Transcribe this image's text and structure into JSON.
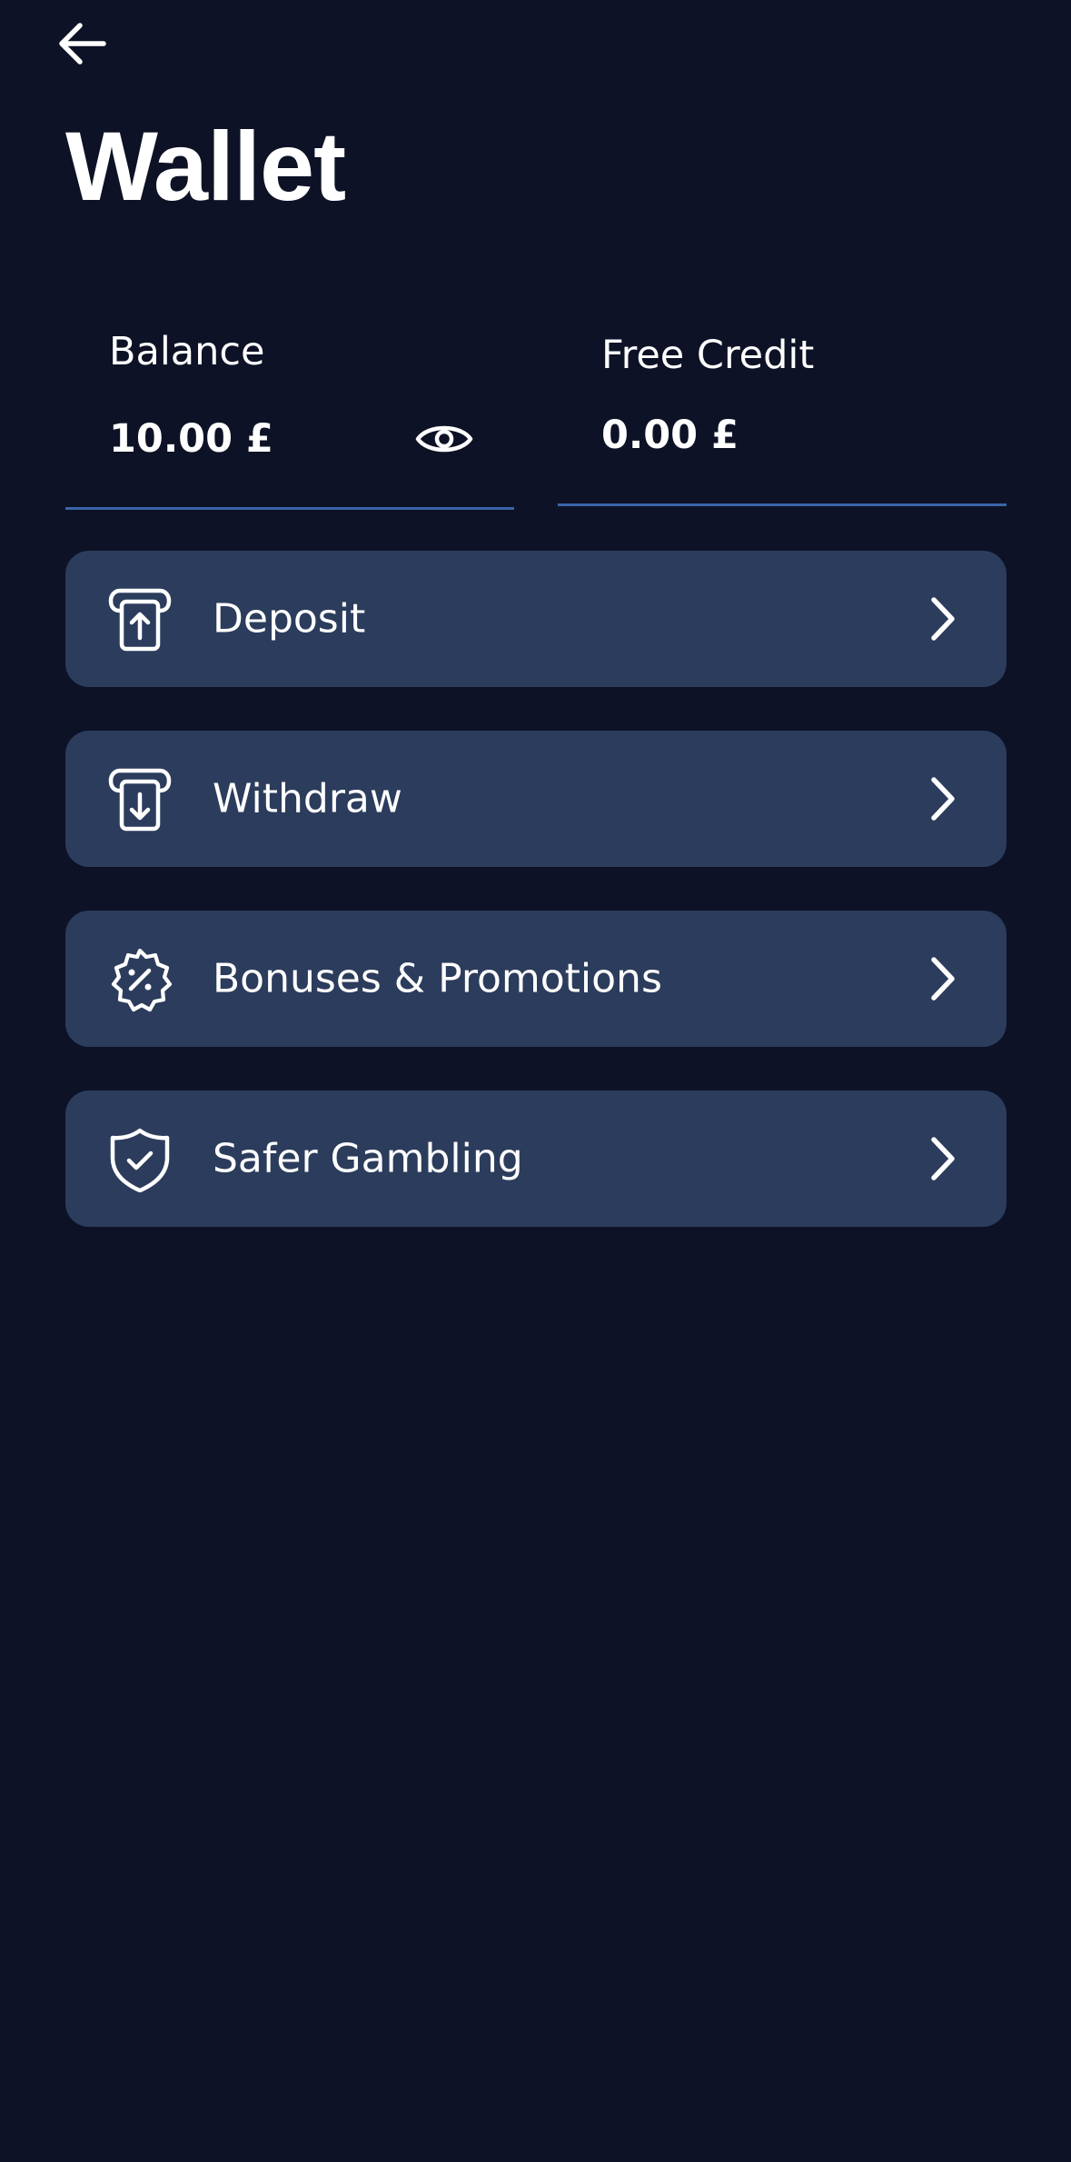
{
  "header": {
    "title": "Wallet",
    "back_icon": "arrow-left-icon"
  },
  "balances": {
    "balance_label": "Balance",
    "balance_value": "10.00 £",
    "balance_visibility_icon": "eye-icon",
    "free_credit_label": "Free Credit",
    "free_credit_value": "0.00 £"
  },
  "menu": {
    "items": [
      {
        "label": "Deposit",
        "icon": "deposit-icon"
      },
      {
        "label": "Withdraw",
        "icon": "withdraw-icon"
      },
      {
        "label": "Bonuses & Promotions",
        "icon": "percent-badge-icon"
      },
      {
        "label": "Safer Gambling",
        "icon": "shield-check-icon"
      }
    ]
  },
  "colors": {
    "background": "#0d1226",
    "card": "#2c3c5c",
    "accent_underline": "#3a64a8",
    "text": "#ffffff"
  }
}
